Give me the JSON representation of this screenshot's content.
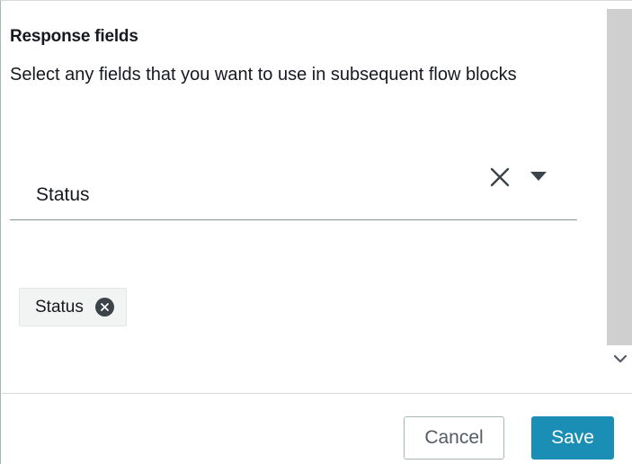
{
  "section": {
    "title": "Response fields",
    "description": "Select any fields that you want to use in subsequent flow blocks"
  },
  "select": {
    "value": "Status",
    "clear_icon": "close-x-icon",
    "caret_icon": "caret-down-icon"
  },
  "tokens": [
    {
      "label": "Status",
      "remove_icon": "remove-circle-x-icon"
    }
  ],
  "scrollbar": {
    "down_icon": "chevron-down-icon"
  },
  "footer": {
    "cancel_label": "Cancel",
    "save_label": "Save"
  },
  "colors": {
    "primary": "#1b8eb5",
    "text": "#16191f",
    "token_bg": "#f2f3f3",
    "token_remove_bg": "#3b4448",
    "scroll_thumb": "#cfcfcf"
  }
}
